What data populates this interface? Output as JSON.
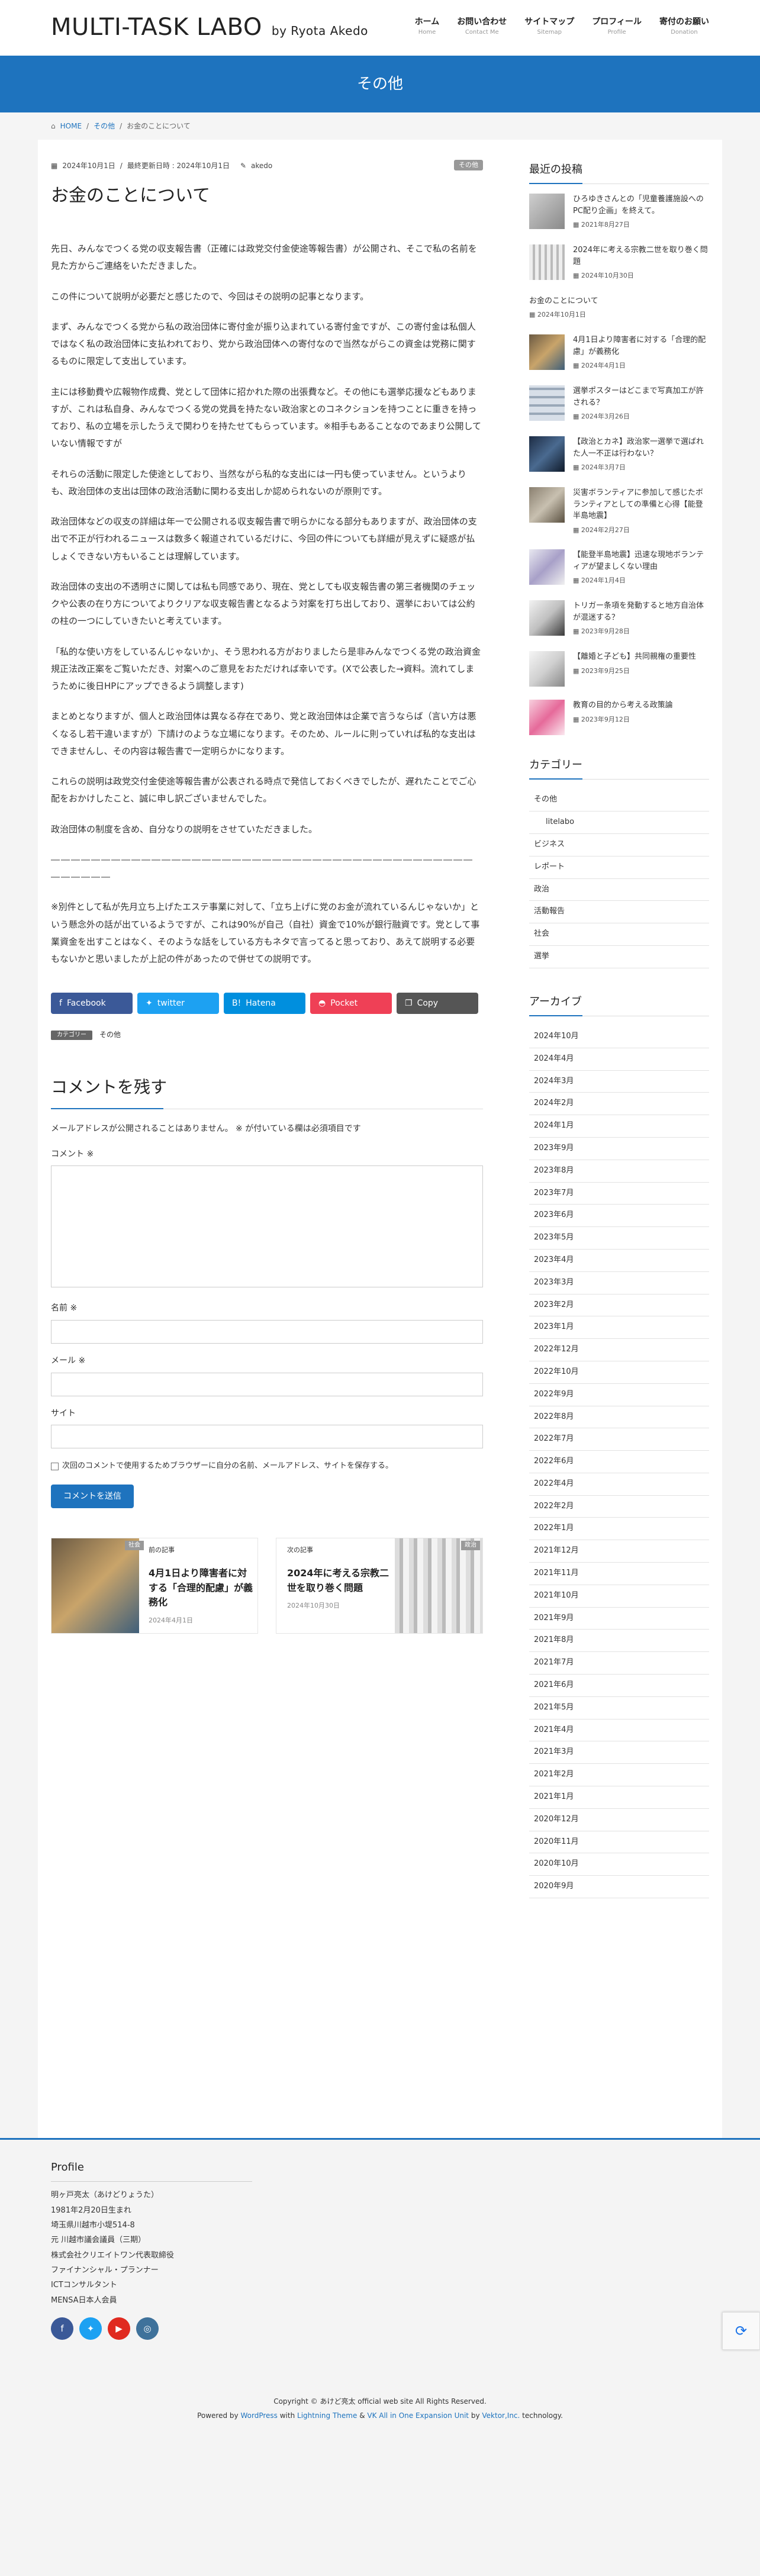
{
  "header": {
    "site_title": "MULTI-TASK LABO",
    "site_byline": "by Ryota Akedo",
    "nav": [
      {
        "ja": "ホーム",
        "en": "Home"
      },
      {
        "ja": "お問い合わせ",
        "en": "Contact Me"
      },
      {
        "ja": "サイトマップ",
        "en": "Sitemap"
      },
      {
        "ja": "プロフィール",
        "en": "Profile"
      },
      {
        "ja": "寄付のお願い",
        "en": "Donation"
      }
    ]
  },
  "page_header": {
    "title": "その他"
  },
  "breadcrumb": {
    "home": "HOME",
    "sep": "/",
    "cat": "その他",
    "current": "お金のことについて"
  },
  "post": {
    "date_published": "2024年10月1日",
    "date_updated": "最終更新日時 : 2024年10月1日",
    "author": "akedo",
    "category_badge": "その他",
    "title": "お金のことについて",
    "paragraphs": [
      "先日、みんなでつくる党の収支報告書（正確には政党交付金使途等報告書）が公開され、そこで私の名前を見た方からご連絡をいただきました。",
      "この件について説明が必要だと感じたので、今回はその説明の記事となります。",
      "まず、みんなでつくる党から私の政治団体に寄付金が振り込まれている寄付金ですが、この寄付金は私個人ではなく私の政治団体に支払われており、党から政治団体への寄付なので当然ながらこの資金は党務に関するものに限定して支出しています。",
      "主には移動費や広報物作成費、党として団体に招かれた際の出張費など。その他にも選挙応援などもありますが、これは私自身、みんなでつくる党の党員を持たない政治家とのコネクションを持つことに重きを持っており、私の立場を示したうえで関わりを持たせてもらっています。※相手もあることなのであまり公開していない情報ですが",
      "それらの活動に限定した使途としており、当然ながら私的な支出には一円も使っていません。というよりも、政治団体の支出は団体の政治活動に関わる支出しか認められないのが原則です。",
      "政治団体などの収支の詳細は年一で公開される収支報告書で明らかになる部分もありますが、政治団体の支出で不正が行われるニュースは数多く報道されているだけに、今回の件についても詳細が見えずに疑惑が払しょくできない方もいることは理解しています。",
      "政治団体の支出の不透明さに関しては私も同感であり、現在、党としても収支報告書の第三者機関のチェックや公表の在り方についてよりクリアな収支報告書となるよう対案を打ち出しており、選挙においては公約の柱の一つにしていきたいと考えています。",
      "「私的な使い方をしているんじゃないか」、そう思われる方がおりましたら是非みんなでつくる党の政治資金規正法改正案をご覧いただき、対案へのご意見をおただければ幸いです。(Xで公表した→資料。流れてしまうために後日HPにアップできるよう調整します)",
      "まとめとなりますが、個人と政治団体は異なる存在であり、党と政治団体は企業で言うならば（言い方は悪くなるし若干違いますが）下請けのような立場になります。そのため、ルールに則っていれば私的な支出はできませんし、その内容は報告書で一定明らかになります。",
      "これらの説明は政党交付金使途等報告書が公表される時点で発信しておくべきでしたが、遅れたことでご心配をおかけしたこと、誠に申し訳ございませんでした。",
      "政治団体の制度を含め、自分なりの説明をさせていただきました。",
      "――――――――――――――――――――――――――――――――――――――――――――――――",
      "※別件として私が先月立ち上げたエステ事業に対して、「立ち上げに党のお金が流れているんじゃないか」という懸念外の話が出ているようですが、これは90%が自己（自社）資金で10%が銀行融資です。党として事業資金を出すことはなく、そのような話をしている方もネタで言ってると思っており、あえて説明する必要もないかと思いましたが上記の件があったので併せての説明です。"
    ]
  },
  "share": [
    {
      "label": "Facebook",
      "icon": "facebook-icon"
    },
    {
      "label": "twitter",
      "icon": "twitter-icon"
    },
    {
      "label": "Hatena",
      "icon": "hatena-icon"
    },
    {
      "label": "Pocket",
      "icon": "pocket-icon"
    },
    {
      "label": "Copy",
      "icon": "copy-icon"
    }
  ],
  "taxonomy": {
    "label": "カテゴリー",
    "value": "その他"
  },
  "comment_form": {
    "title": "コメントを残す",
    "note": "メールアドレスが公開されることはありません。 ※ が付いている欄は必須項目です",
    "comment_label": "コメント ※",
    "name_label": "名前 ※",
    "email_label": "メール ※",
    "site_label": "サイト",
    "cookie_label": "次回のコメントで使用するためブラウザーに自分の名前、メールアドレス、サイトを保存する。",
    "submit": "コメントを送信"
  },
  "post_nav": {
    "prev": {
      "kind": "前の記事",
      "tag": "社会",
      "title": "4月1日より障害者に対する「合理的配慮」が義務化",
      "date": "2024年4月1日"
    },
    "next": {
      "kind": "次の記事",
      "tag": "政治",
      "title": "2024年に考える宗教二世を取り巻く問題",
      "date": "2024年10月30日"
    }
  },
  "sidebar": {
    "recent_title": "最近の投稿",
    "recent": [
      {
        "title": "ひろゆきさんとの「児童養護施設へのPC配り企画」を終えて。",
        "date": "2021年8月27日"
      },
      {
        "title": "2024年に考える宗教二世を取り巻く問題",
        "date": "2024年10月30日"
      },
      {
        "title": "お金のことについて",
        "date": "2024年10月1日"
      },
      {
        "title": "4月1日より障害者に対する「合理的配慮」が義務化",
        "date": "2024年4月1日"
      },
      {
        "title": "選挙ポスターはどこまで写真加工が許される？",
        "date": "2024年3月26日"
      },
      {
        "title": "【政治とカネ】政治家一選挙で選ばれた人一不正は行わない？",
        "date": "2024年3月7日"
      },
      {
        "title": "災害ボランティアに参加して感じたボランティアとしての準備と心得【能登半島地震】",
        "date": "2024年2月27日"
      },
      {
        "title": "【能登半島地震】迅速な現地ボランティアが望ましくない理由",
        "date": "2024年1月4日"
      },
      {
        "title": "トリガー条項を発動すると地方自治体が混迷する？",
        "date": "2023年9月28日"
      },
      {
        "title": "【離婚と子ども】共同親権の重要性",
        "date": "2023年9月25日"
      },
      {
        "title": "教育の目的から考える政策論",
        "date": "2023年9月12日"
      }
    ],
    "cat_title": "カテゴリー",
    "categories": [
      {
        "label": "その他",
        "child": false
      },
      {
        "label": "litelabo",
        "child": true
      },
      {
        "label": "ビジネス",
        "child": false
      },
      {
        "label": "レポート",
        "child": false
      },
      {
        "label": "政治",
        "child": false
      },
      {
        "label": "活動報告",
        "child": false
      },
      {
        "label": "社会",
        "child": false
      },
      {
        "label": "選挙",
        "child": false
      }
    ],
    "arch_title": "アーカイブ",
    "archives": [
      "2024年10月",
      "2024年4月",
      "2024年3月",
      "2024年2月",
      "2024年1月",
      "2023年9月",
      "2023年8月",
      "2023年7月",
      "2023年6月",
      "2023年5月",
      "2023年4月",
      "2023年3月",
      "2023年2月",
      "2023年1月",
      "2022年12月",
      "2022年10月",
      "2022年9月",
      "2022年8月",
      "2022年7月",
      "2022年6月",
      "2022年4月",
      "2022年2月",
      "2022年1月",
      "2021年12月",
      "2021年11月",
      "2021年10月",
      "2021年9月",
      "2021年8月",
      "2021年7月",
      "2021年6月",
      "2021年5月",
      "2021年4月",
      "2021年3月",
      "2021年2月",
      "2021年1月",
      "2020年12月",
      "2020年11月",
      "2020年10月",
      "2020年9月"
    ]
  },
  "footer": {
    "profile_title": "Profile",
    "profile_lines": [
      "明ヶ戸亮太（あけどりょうた）",
      "1981年2月20日生まれ",
      "埼玉県川越市小堤514-8",
      "元 川越市議会議員（三期）",
      "株式会社クリエイトワン代表取締役",
      "ファイナンシャル・プランナー",
      "ICTコンサルタント",
      "MENSA日本人会員"
    ],
    "social": [
      "facebook-icon",
      "twitter-icon",
      "youtube-icon",
      "instagram-icon"
    ],
    "copyright": "Copyright © あけど亮太 official web site All Rights Reserved.",
    "powered_prefix": "Powered by",
    "powered_wp": "WordPress",
    "powered_with": "with",
    "powered_theme": "Lightning Theme",
    "powered_amp": "&",
    "powered_vk": "VK All in One Expansion Unit",
    "powered_by": "by",
    "powered_vektor": "Vektor,Inc.",
    "powered_suffix": "technology."
  }
}
